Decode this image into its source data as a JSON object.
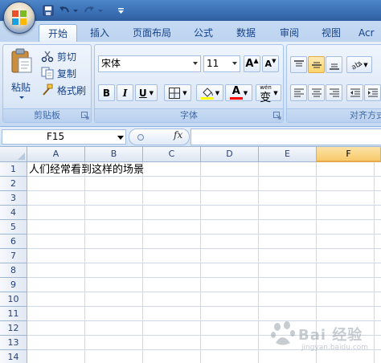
{
  "quick_access": {
    "icons": [
      "office-logo",
      "save-icon",
      "undo-icon",
      "redo-icon",
      "customize-icon"
    ]
  },
  "tabs": [
    {
      "label": "开始",
      "active": true
    },
    {
      "label": "插入"
    },
    {
      "label": "页面布局"
    },
    {
      "label": "公式"
    },
    {
      "label": "数据"
    },
    {
      "label": "审阅"
    },
    {
      "label": "视图"
    },
    {
      "label": "Acr"
    }
  ],
  "clipboard": {
    "group_label": "剪贴板",
    "paste_label": "粘贴",
    "cut_label": "剪切",
    "copy_label": "复制",
    "format_painter_label": "格式刷"
  },
  "font": {
    "group_label": "字体",
    "font_name": "宋体",
    "font_size": "11",
    "bold": "B",
    "italic": "I",
    "underline": "U",
    "grow": "A",
    "shrink": "A",
    "font_color_letter": "A",
    "phonetic": "变",
    "phonetic_small": "wén",
    "colors": {
      "highlight": "#ffff00",
      "font_color": "#ff0000"
    }
  },
  "alignment": {
    "group_label": "对齐方式"
  },
  "formula_bar": {
    "name_box": "F15",
    "fx": "fx",
    "value": ""
  },
  "sheet": {
    "columns": [
      "A",
      "B",
      "C",
      "D",
      "E",
      "F"
    ],
    "selected_column": "F",
    "rows": [
      "1",
      "2",
      "3",
      "4",
      "5",
      "6",
      "7",
      "8",
      "9",
      "10",
      "11",
      "12",
      "13",
      "14"
    ],
    "cell_a1": "人们经常看到这样的场景"
  },
  "watermark": {
    "text": "Bai 经验",
    "sub": "jingyan.baidu.com"
  },
  "colors": {
    "accent": "#15428b",
    "ribbon_bg": "#d5e4f6",
    "selected_header": "#f8c96b"
  }
}
